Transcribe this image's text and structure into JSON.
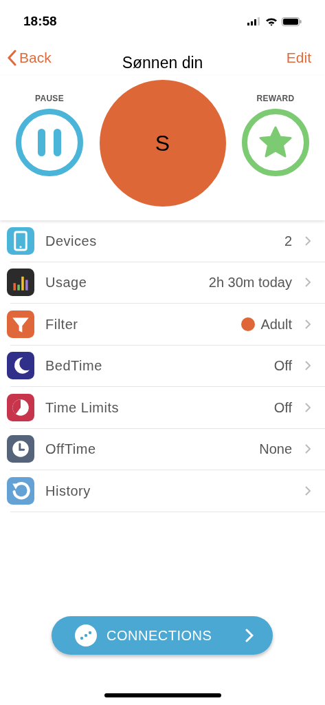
{
  "status_bar": {
    "time": "18:58"
  },
  "nav": {
    "back": "Back",
    "title": "Sønnen din",
    "edit": "Edit"
  },
  "actions": {
    "pause": {
      "label": "PAUSE"
    },
    "avatar": {
      "initial": "S",
      "color": "#de6737"
    },
    "reward": {
      "label": "REWARD"
    }
  },
  "rows": [
    {
      "kind": "devices",
      "label": "Devices",
      "value": "2",
      "color": "#4bb4d9"
    },
    {
      "kind": "usage",
      "label": "Usage",
      "value": "2h 30m today",
      "color": "#2b2b2b"
    },
    {
      "kind": "filter",
      "label": "Filter",
      "value": "Adult",
      "color": "#e0673a",
      "dot": {
        "color": "#df6636"
      }
    },
    {
      "kind": "bedtime",
      "label": "BedTime",
      "value": "Off",
      "color": "#30308a"
    },
    {
      "kind": "limits",
      "label": "Time Limits",
      "value": "Off",
      "color": "#c6354c"
    },
    {
      "kind": "offtime",
      "label": "OffTime",
      "value": "None",
      "color": "#55647a"
    },
    {
      "kind": "history",
      "label": "History",
      "color": "#64a2d6"
    }
  ],
  "connections_button": {
    "label": "CONNECTIONS"
  }
}
